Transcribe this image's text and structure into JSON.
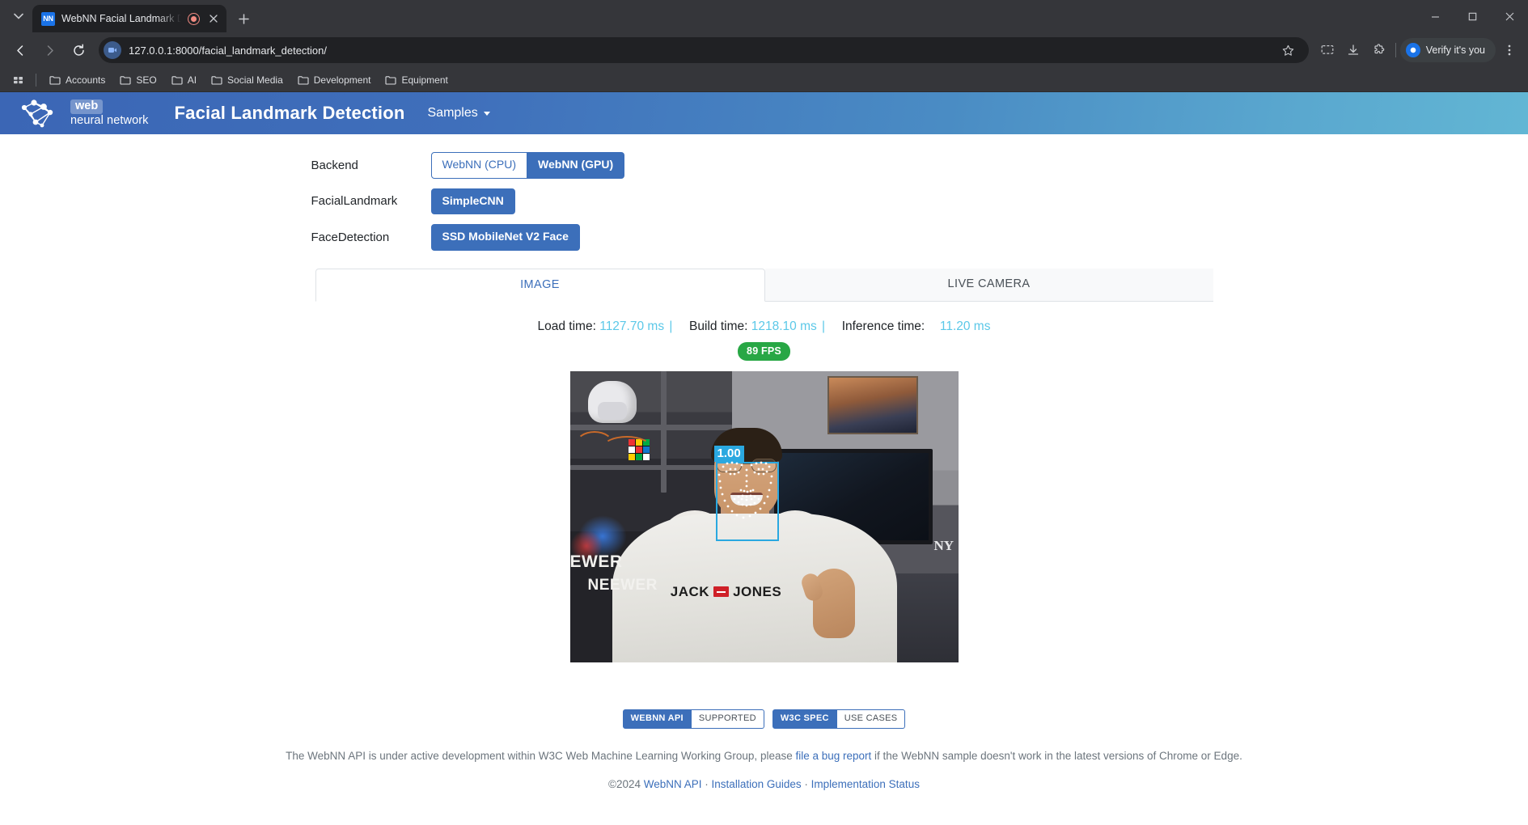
{
  "browser": {
    "tab": {
      "favicon_text": "NN",
      "title": "WebNN Facial Landmark De",
      "recording_icon": "record-icon",
      "close_icon": "close-icon"
    },
    "new_tab_icon": "plus-icon",
    "nav": {
      "back_icon": "back-arrow-icon",
      "forward_icon": "forward-arrow-icon",
      "reload_icon": "reload-icon"
    },
    "omnibox": {
      "url": "127.0.0.1:8000/facial_landmark_detection/",
      "site_icon": "camera-permission-icon",
      "star_icon": "bookmark-star-icon"
    },
    "toolbar_icons": [
      "screen-share-icon",
      "downloads-icon",
      "extensions-icon"
    ],
    "verify_button": "Verify it's you",
    "menu_icon": "kebab-menu-icon",
    "window_controls": [
      "minimize-icon",
      "maximize-icon",
      "close-window-icon"
    ],
    "bookmarks": [
      "Accounts",
      "SEO",
      "AI",
      "Social Media",
      "Development",
      "Equipment"
    ],
    "apps_icon": "apps-grid-icon"
  },
  "navbar": {
    "logo_web": "web",
    "logo_nn": "neural network",
    "title": "Facial Landmark Detection",
    "samples": "Samples"
  },
  "controls": [
    {
      "label": "Backend",
      "options": [
        {
          "text": "WebNN (CPU)",
          "active": false
        },
        {
          "text": "WebNN (GPU)",
          "active": true
        }
      ]
    },
    {
      "label": "FacialLandmark",
      "options": [
        {
          "text": "SimpleCNN",
          "active": true
        }
      ]
    },
    {
      "label": "FaceDetection",
      "options": [
        {
          "text": "SSD MobileNet V2 Face",
          "active": true
        }
      ]
    }
  ],
  "tabs": [
    {
      "label": "IMAGE",
      "active": true
    },
    {
      "label": "LIVE CAMERA",
      "active": false
    }
  ],
  "stats": {
    "load_label": "Load time:",
    "load_value": "1127.70 ms",
    "build_label": "Build time:",
    "build_value": "1218.10 ms",
    "inference_label": "Inference time:",
    "inference_value": "11.20 ms",
    "separator": "|",
    "fps": "89 FPS"
  },
  "detection": {
    "score": "1.00",
    "box_color": "#2aa8e0"
  },
  "photo_text": {
    "brand": "JACK",
    "brand2": "JONES",
    "light1": "EWER",
    "light2": "NEEWER",
    "monitor_logo": "NY"
  },
  "footer": {
    "badges": [
      {
        "left": "WEBNN API",
        "right": "SUPPORTED"
      },
      {
        "left": "W3C SPEC",
        "right": "USE CASES"
      }
    ],
    "note_pre": "The WebNN API is under active development within W3C Web Machine Learning Working Group, please ",
    "note_link": "file a bug report",
    "note_post": " if the WebNN sample doesn't work in the latest versions of Chrome or Edge.",
    "copy_year": "©2024 ",
    "copy_link1": "WebNN API",
    "copy_sep1": " · ",
    "copy_link2": "Installation Guides",
    "copy_sep2": " · ",
    "copy_link3": "Implementation Status"
  },
  "colors": {
    "accent": "#3c6fba",
    "stat_value": "#5bc8e8",
    "fps_badge": "#28a745",
    "navbar_start": "#3b66b5",
    "navbar_end": "#62b6d4"
  }
}
